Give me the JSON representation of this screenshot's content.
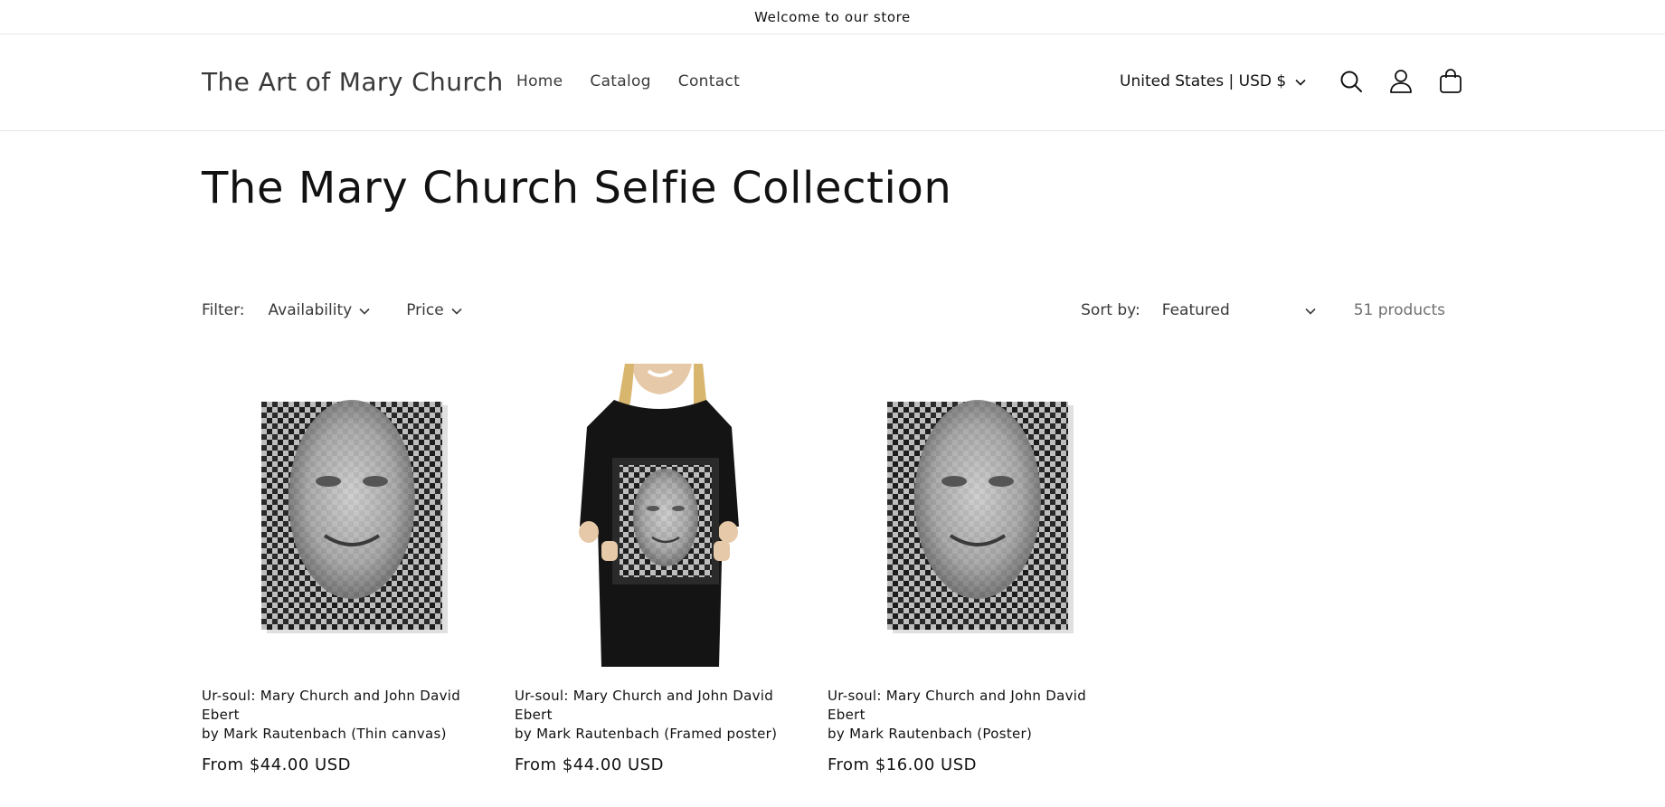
{
  "announcement": "Welcome to our store",
  "header": {
    "logo": "The Art of Mary Church",
    "nav": [
      "Home",
      "Catalog",
      "Contact"
    ],
    "country": "United States | USD $"
  },
  "collection": {
    "title": "The Mary Church Selfie Collection",
    "filter_label": "Filter:",
    "filters": [
      "Availability",
      "Price"
    ],
    "sort_label": "Sort by:",
    "sort_value": "Featured",
    "product_count": "51 products"
  },
  "products": [
    {
      "title_line1": "Ur-soul: Mary Church and John David Ebert",
      "title_line2": "by Mark Rautenbach (Thin canvas)",
      "price": "From $44.00 USD",
      "image": "woven-portrait-canvas"
    },
    {
      "title_line1": "Ur-soul: Mary Church and John David Ebert",
      "title_line2": "by Mark Rautenbach (Framed poster)",
      "price": "From $44.00 USD",
      "image": "model-holding-framed-poster"
    },
    {
      "title_line1": "Ur-soul: Mary Church and John David Ebert",
      "title_line2": "by Mark Rautenbach (Poster)",
      "price": "From $16.00 USD",
      "image": "woven-portrait-poster"
    }
  ],
  "icons": [
    "chevron-down-icon",
    "search-icon",
    "account-icon",
    "cart-icon"
  ]
}
